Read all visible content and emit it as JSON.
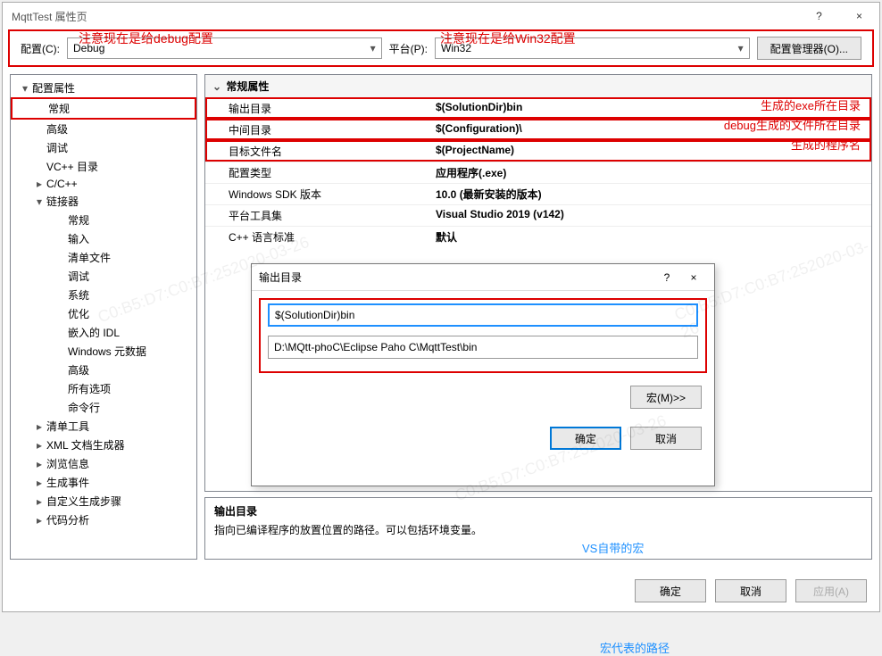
{
  "title": "MqttTest 属性页",
  "winControls": {
    "help": "?",
    "close": "×"
  },
  "annotations": {
    "debugNote": "注意现在是给debug配置",
    "win32Note": "注意现在是给Win32配置",
    "vsMacro": "VS自带的宏",
    "macroPath": "宏代表的路径",
    "exeDir": "生成的exe所在目录",
    "debugDir": "debug生成的文件所在目录",
    "progName": "生成的程序名"
  },
  "top": {
    "configLabel": "配置(C):",
    "configValue": "Debug",
    "platformLabel": "平台(P):",
    "platformValue": "Win32",
    "managerBtn": "配置管理器(O)..."
  },
  "tree": [
    {
      "label": "配置属性",
      "level": 0,
      "toggle": "▾"
    },
    {
      "label": "常规",
      "level": 1,
      "selected": true
    },
    {
      "label": "高级",
      "level": 1
    },
    {
      "label": "调试",
      "level": 1
    },
    {
      "label": "VC++ 目录",
      "level": 1
    },
    {
      "label": "C/C++",
      "level": 1,
      "toggle": "▸"
    },
    {
      "label": "链接器",
      "level": 1,
      "toggle": "▾"
    },
    {
      "label": "常规",
      "level": 2
    },
    {
      "label": "输入",
      "level": 2
    },
    {
      "label": "清单文件",
      "level": 2
    },
    {
      "label": "调试",
      "level": 2
    },
    {
      "label": "系统",
      "level": 2
    },
    {
      "label": "优化",
      "level": 2
    },
    {
      "label": "嵌入的 IDL",
      "level": 2
    },
    {
      "label": "Windows 元数据",
      "level": 2
    },
    {
      "label": "高级",
      "level": 2
    },
    {
      "label": "所有选项",
      "level": 2
    },
    {
      "label": "命令行",
      "level": 2
    },
    {
      "label": "清单工具",
      "level": 1,
      "toggle": "▸"
    },
    {
      "label": "XML 文档生成器",
      "level": 1,
      "toggle": "▸"
    },
    {
      "label": "浏览信息",
      "level": 1,
      "toggle": "▸"
    },
    {
      "label": "生成事件",
      "level": 1,
      "toggle": "▸"
    },
    {
      "label": "自定义生成步骤",
      "level": 1,
      "toggle": "▸"
    },
    {
      "label": "代码分析",
      "level": 1,
      "toggle": "▸"
    }
  ],
  "grid": {
    "header": "常规属性",
    "rows": [
      {
        "k": "输出目录",
        "v": "$(SolutionDir)bin",
        "hl": true
      },
      {
        "k": "中间目录",
        "v": "$(Configuration)\\",
        "hl": true
      },
      {
        "k": "目标文件名",
        "v": "$(ProjectName)",
        "hl": true
      },
      {
        "k": "配置类型",
        "v": "应用程序(.exe)"
      },
      {
        "k": "Windows SDK 版本",
        "v": "10.0 (最新安装的版本)"
      },
      {
        "k": "平台工具集",
        "v": "Visual Studio 2019 (v142)"
      },
      {
        "k": "C++ 语言标准",
        "v": "默认"
      }
    ]
  },
  "desc": {
    "title": "输出目录",
    "text": "指向已编译程序的放置位置的路径。可以包括环境变量。"
  },
  "footer": {
    "ok": "确定",
    "cancel": "取消",
    "apply": "应用(A)"
  },
  "popup": {
    "title": "输出目录",
    "help": "?",
    "close": "×",
    "input": "$(SolutionDir)bin",
    "resolved": "D:\\MQtt-phoC\\Eclipse Paho C\\MqttTest\\bin",
    "macroBtn": "宏(M)>>",
    "ok": "确定",
    "cancel": "取消"
  },
  "watermark": "C0:B5:D7:C0:B7:252020-03-26"
}
